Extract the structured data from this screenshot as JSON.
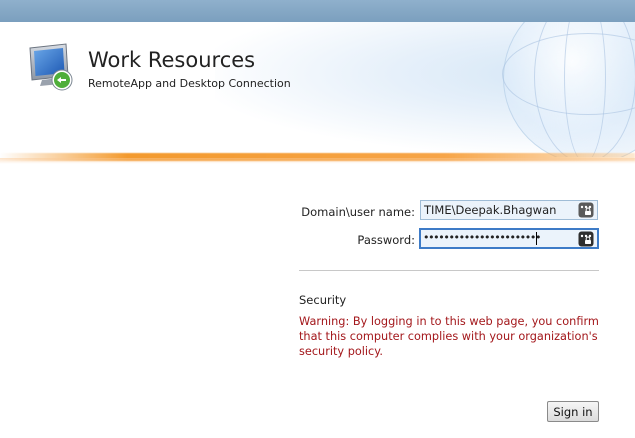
{
  "header": {
    "title": "Work Resources",
    "subtitle": "RemoteApp and Desktop Connection",
    "logo_icon": "remote-desktop-computer-icon"
  },
  "login_form": {
    "username_label": "Domain\\user name:",
    "username_value": "TIME\\Deepak.Bhagwan",
    "password_label": "Password:",
    "password_mask": "•••••••••••••••••••••••",
    "credential_icon": "password-manager-key-icon"
  },
  "security": {
    "heading": "Security",
    "warning": "Warning: By logging in to this web page, you confirm that this computer complies with your organization's security policy.",
    "warning_color": "#a3171b"
  },
  "actions": {
    "sign_in_label": "Sign in"
  },
  "colors": {
    "top_bar": "#7b9fbe",
    "accent_line": "#f39a2e",
    "input_background": "#ebf3fb",
    "focus_border": "#3d7bc7"
  }
}
